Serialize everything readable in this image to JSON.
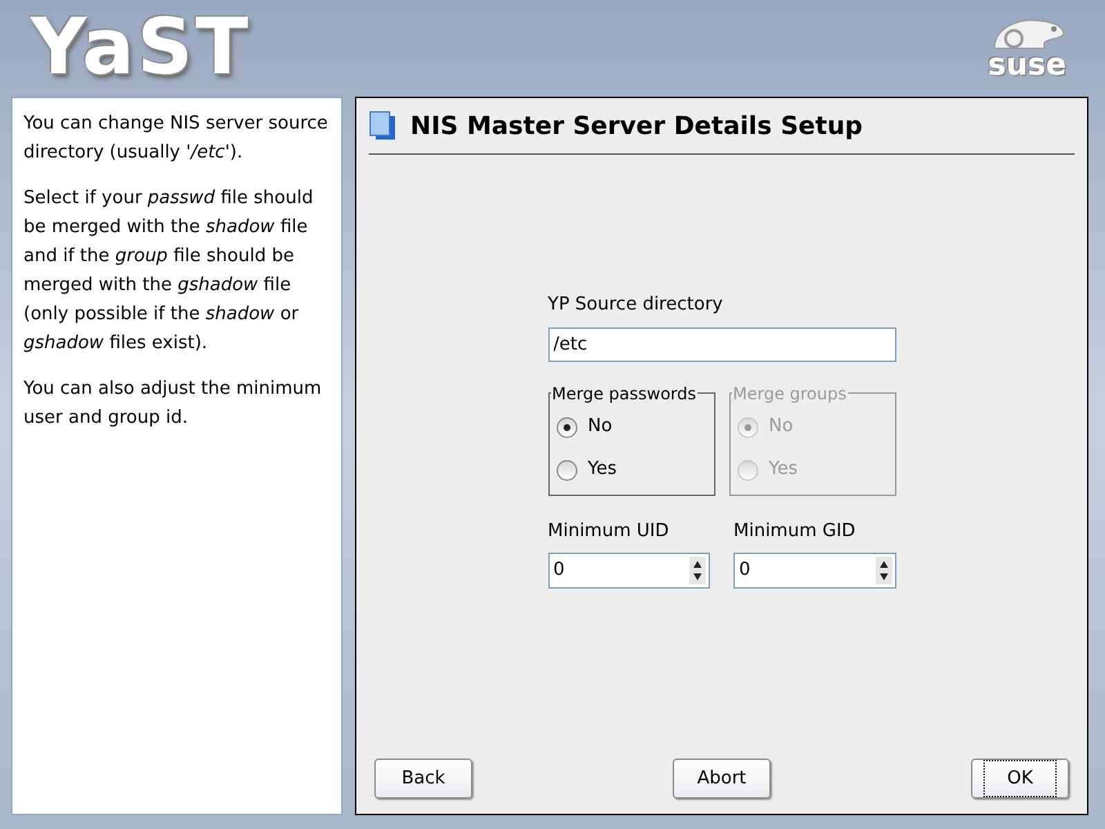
{
  "header": {
    "logo": "YaST",
    "brand": "suse"
  },
  "help": [
    "You can change NIS server source directory (usually '*/etc*').",
    "Select if your *passwd* file should be merged with the *shadow* file and if the *group* file should be merged with the *gshadow* file (only possible if the *shadow* or *gshadow* files exist).",
    "You can also adjust the minimum user and group id."
  ],
  "dialog": {
    "title": "NIS Master Server Details Setup",
    "source": {
      "label": "YP Source directory",
      "value": "/etc"
    },
    "groups": [
      {
        "title": "Merge passwords",
        "disabled": false,
        "options": [
          {
            "label": "No",
            "selected": true
          },
          {
            "label": "Yes",
            "selected": false
          }
        ]
      },
      {
        "title": "Merge groups",
        "disabled": true,
        "options": [
          {
            "label": "No",
            "selected": true
          },
          {
            "label": "Yes",
            "selected": false
          }
        ]
      }
    ],
    "spinners": [
      {
        "label": "Minimum UID",
        "value": "0"
      },
      {
        "label": "Minimum GID",
        "value": "0"
      }
    ],
    "buttons": [
      {
        "label": "Back",
        "focused": false
      },
      {
        "label": "Abort",
        "focused": false
      },
      {
        "label": "OK",
        "focused": true
      }
    ]
  }
}
